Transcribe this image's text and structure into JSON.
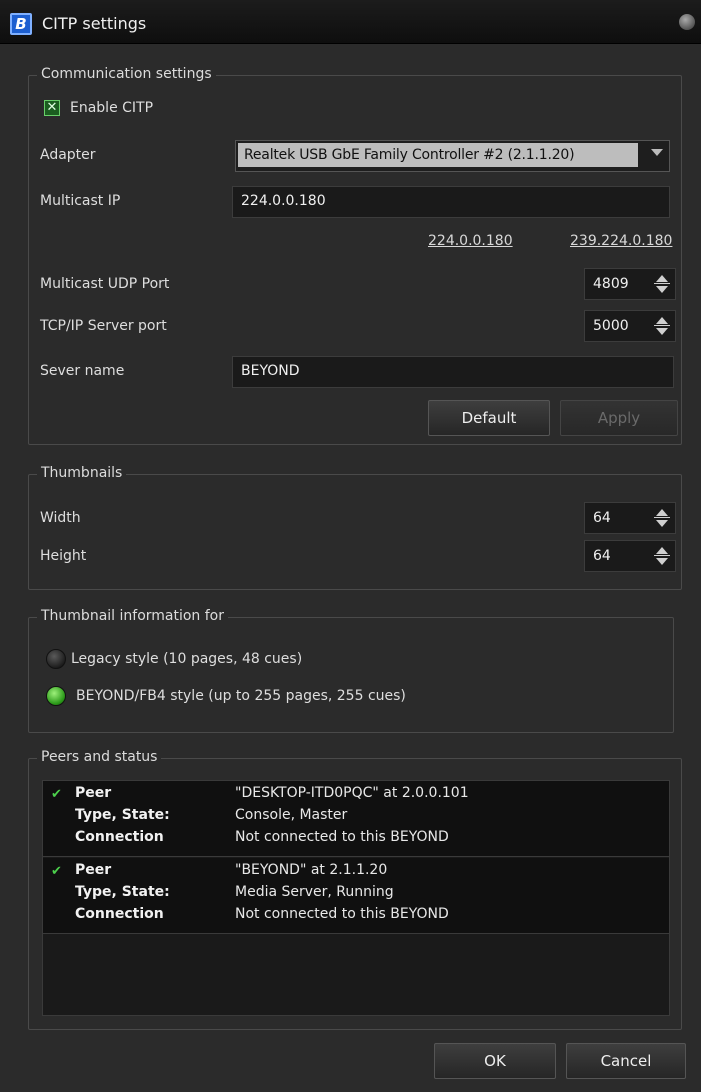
{
  "window": {
    "title": "CITP settings",
    "icon": "beyond-logo-icon"
  },
  "communication": {
    "legend": "Communication settings",
    "enable_label": "Enable CITP",
    "enable_checked": true,
    "adapter_label": "Adapter",
    "adapter_value": "Realtek USB GbE Family Controller #2 (2.1.1.20)",
    "multicast_ip_label": "Multicast IP",
    "multicast_ip_value": "224.0.0.180",
    "preset_1": "224.0.0.180",
    "preset_2": "239.224.0.180",
    "udp_port_label": "Multicast UDP Port",
    "udp_port_value": "4809",
    "tcp_port_label": "TCP/IP Server port",
    "tcp_port_value": "5000",
    "server_name_label": "Sever name",
    "server_name_value": "BEYOND",
    "default_label": "Default",
    "apply_label": "Apply"
  },
  "thumbnails": {
    "legend": "Thumbnails",
    "width_label": "Width",
    "width_value": "64",
    "height_label": "Height",
    "height_value": "64"
  },
  "thumbinfo": {
    "legend": "Thumbnail information for",
    "legacy_label": "Legacy style (10 pages, 48 cues)",
    "beyond_label": "BEYOND/FB4 style (up to 255 pages, 255 cues)",
    "selected": "beyond"
  },
  "peers": {
    "legend": "Peers and status",
    "keys": {
      "peer": "Peer",
      "type": "Type, State:",
      "connection": "Connection"
    },
    "items": [
      {
        "peer": "\"DESKTOP-ITD0PQC\" at 2.0.0.101",
        "type": "Console, Master",
        "connection": "Not connected to this BEYOND"
      },
      {
        "peer": "\"BEYOND\" at 2.1.1.20",
        "type": "Media Server, Running",
        "connection": "Not connected to this BEYOND"
      }
    ]
  },
  "footer": {
    "ok_label": "OK",
    "cancel_label": "Cancel"
  }
}
